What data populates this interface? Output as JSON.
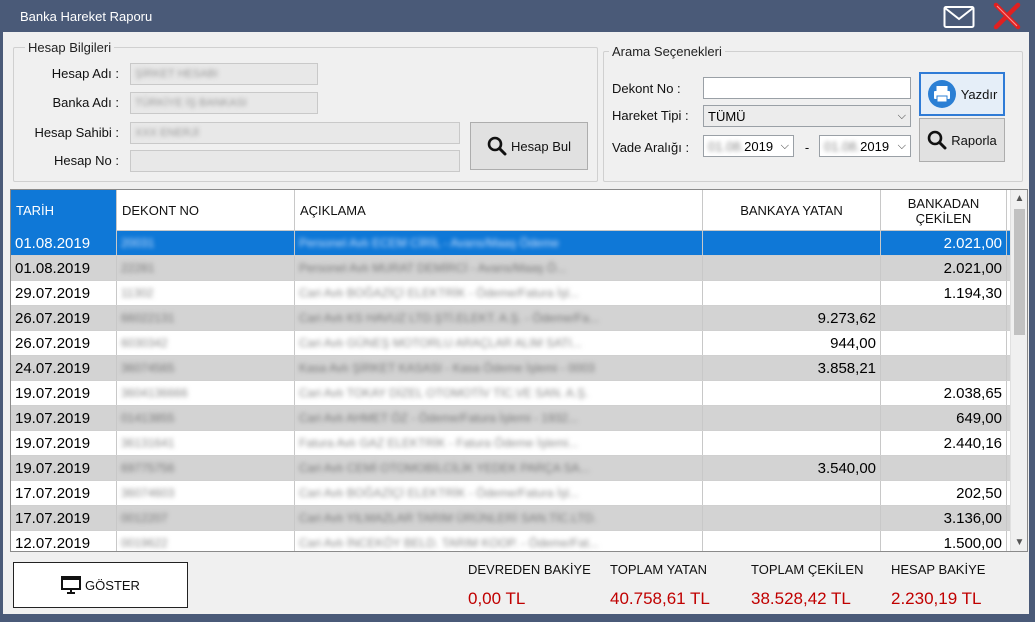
{
  "window": {
    "title": "Banka Hareket Raporu"
  },
  "account": {
    "legend": "Hesap Bilgileri",
    "fields": [
      {
        "label": "Hesap Adı :",
        "value": "ŞİRKET HESABI"
      },
      {
        "label": "Banka Adı :",
        "value": "TÜRKİYE İŞ BANKASI"
      },
      {
        "label": "Hesap Sahibi :",
        "value": "XXX ENERJİ"
      },
      {
        "label": "Hesap No :",
        "value": ""
      }
    ],
    "find_button": "Hesap Bul"
  },
  "search": {
    "legend": "Arama Seçenekleri",
    "dekont_label": "Dekont No :",
    "dekont_value": "",
    "type_label": "Hareket Tipi :",
    "type_value": "TÜMÜ",
    "range_label": "Vade Aralığı :",
    "range_from_masked": "01.08.",
    "range_from_year": "2019",
    "range_separator": "-",
    "range_to_masked": "01.08.",
    "range_to_year": "2019",
    "print_button": "Yazdır",
    "report_button": "Raporla"
  },
  "grid": {
    "columns": [
      "TARİH",
      "DEKONT NO",
      "AÇIKLAMA",
      "BANKAYA YATAN",
      "BANKADAN ÇEKİLEN"
    ],
    "rows": [
      {
        "date": "01.08.2019",
        "dekont": "20031",
        "desc": "Personel Avlı ECEM CİRİL - Avans/Maaş Ödeme",
        "in": "",
        "out": "2.021,00"
      },
      {
        "date": "01.08.2019",
        "dekont": "22281",
        "desc": "Personel Avlı MURAT DEMİRCİ - Avans/Maaş Ö...",
        "in": "",
        "out": "2.021,00"
      },
      {
        "date": "29.07.2019",
        "dekont": "11302",
        "desc": "Cari Avlı BOĞAZİÇİ ELEKTRİK - Ödeme/Fatura İşl...",
        "in": "",
        "out": "1.194,30"
      },
      {
        "date": "26.07.2019",
        "dekont": "66022131",
        "desc": "Cari Avlı KS HAVUZ LTD.ŞTİ.ELEKT. A.Ş. - Ödeme/Fa...",
        "in": "9.273,62",
        "out": ""
      },
      {
        "date": "26.07.2019",
        "dekont": "6030342",
        "desc": "Cari Avlı GÜNEŞ MOTORLU ARAÇLAR ALIM SATI...",
        "in": "944,00",
        "out": ""
      },
      {
        "date": "24.07.2019",
        "dekont": "36074565",
        "desc": "Kasa Avlı ŞİRKET KASASI - Kasa Ödeme İşlemi - 0003",
        "in": "3.858,21",
        "out": ""
      },
      {
        "date": "19.07.2019",
        "dekont": "3604136666",
        "desc": "Cari Avlı TOKAY DİZEL OTOMOTİV TİC.VE SAN. A.Ş.",
        "in": "",
        "out": "2.038,65"
      },
      {
        "date": "19.07.2019",
        "dekont": "01413855",
        "desc": "Cari Avlı AHMET ÖZ - Ödeme/Fatura İşlemi - 1932...",
        "in": "",
        "out": "649,00"
      },
      {
        "date": "19.07.2019",
        "dekont": "36131641",
        "desc": "Fatura Avlı GAZ ELEKTRİK - Fatura Ödeme İşlemi...",
        "in": "",
        "out": "2.440,16"
      },
      {
        "date": "19.07.2019",
        "dekont": "69775756",
        "desc": "Cari Avlı CEMİ OTOMOBİLCİLİK YEDEK PARÇA SA...",
        "in": "3.540,00",
        "out": ""
      },
      {
        "date": "17.07.2019",
        "dekont": "36074603",
        "desc": "Cari Avlı BOĞAZİÇİ ELEKTRİK - Ödeme/Fatura İşl...",
        "in": "",
        "out": "202,50"
      },
      {
        "date": "17.07.2019",
        "dekont": "0012207",
        "desc": "Cari Avlı YILMAZLAR TARIM ÜRÜNLERİ SAN.TİC.LTD.",
        "in": "",
        "out": "3.136,00"
      },
      {
        "date": "12.07.2019",
        "dekont": "0019622",
        "desc": "Cari Avlı İNCEKÖY BELD. TARIM KOOP. - Ödeme/Fat...",
        "in": "",
        "out": "1.500,00"
      }
    ]
  },
  "footer": {
    "show_button": "GÖSTER",
    "summary": [
      {
        "label": "DEVREDEN BAKİYE",
        "value": "0,00 TL"
      },
      {
        "label": "TOPLAM YATAN",
        "value": "40.758,61 TL"
      },
      {
        "label": "TOPLAM ÇEKİLEN",
        "value": "38.528,42 TL"
      },
      {
        "label": "HESAP BAKİYE",
        "value": "2.230,19 TL"
      }
    ]
  },
  "colors": {
    "titlebar": "#4a5a78",
    "selection": "#0f78d7",
    "alt_row": "#d3d3d3",
    "total_value": "#c00000"
  }
}
